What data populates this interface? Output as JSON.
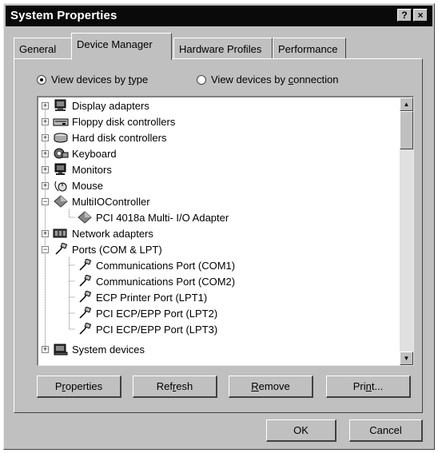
{
  "window": {
    "title": "System Properties",
    "help_label": "?",
    "close_label": "×"
  },
  "tabs": [
    {
      "label": "General"
    },
    {
      "label": "Device Manager"
    },
    {
      "label": "Hardware Profiles"
    },
    {
      "label": "Performance"
    }
  ],
  "view": {
    "by_type": {
      "prefix": "View devices by ",
      "accel": "t",
      "suffix": "ype",
      "selected": true
    },
    "by_connection": {
      "prefix": "View devices by ",
      "accel": "c",
      "suffix": "onnection",
      "selected": false
    }
  },
  "tree": [
    {
      "label": "Display adapters",
      "level": 0,
      "expander": "+",
      "icon": "display-adapter-icon"
    },
    {
      "label": "Floppy disk controllers",
      "level": 0,
      "expander": "+",
      "icon": "floppy-controller-icon"
    },
    {
      "label": "Hard disk controllers",
      "level": 0,
      "expander": "+",
      "icon": "hard-disk-controller-icon"
    },
    {
      "label": "Keyboard",
      "level": 0,
      "expander": "+",
      "icon": "keyboard-icon"
    },
    {
      "label": "Monitors",
      "level": 0,
      "expander": "+",
      "icon": "monitor-icon"
    },
    {
      "label": "Mouse",
      "level": 0,
      "expander": "+",
      "icon": "mouse-icon"
    },
    {
      "label": "MultiIOController",
      "level": 0,
      "expander": "-",
      "icon": "diamond-device-icon"
    },
    {
      "label": "PCI 4018a Multi- I/O Adapter",
      "level": 1,
      "icon": "diamond-device-icon"
    },
    {
      "label": "Network adapters",
      "level": 0,
      "expander": "+",
      "icon": "network-adapter-icon"
    },
    {
      "label": "Ports (COM & LPT)",
      "level": 0,
      "expander": "-",
      "icon": "port-connector-icon"
    },
    {
      "label": "Communications Port (COM1)",
      "level": 1,
      "icon": "port-connector-icon"
    },
    {
      "label": "Communications Port (COM2)",
      "level": 1,
      "icon": "port-connector-icon"
    },
    {
      "label": "ECP Printer Port (LPT1)",
      "level": 1,
      "icon": "port-connector-icon"
    },
    {
      "label": "PCI ECP/EPP Port (LPT2)",
      "level": 1,
      "icon": "port-connector-icon"
    },
    {
      "label": "PCI ECP/EPP Port (LPT3)",
      "level": 1,
      "icon": "port-connector-icon"
    },
    {
      "label": "System devices",
      "level": 0,
      "expander": "+",
      "icon": "system-devices-icon"
    }
  ],
  "buttons": {
    "properties": {
      "pre": "P",
      "accel": "r",
      "post": "operties"
    },
    "refresh": {
      "pre": "Ref",
      "accel": "r",
      "post": "esh"
    },
    "remove": {
      "pre": "",
      "accel": "R",
      "post": "emove"
    },
    "print": {
      "pre": "Pri",
      "accel": "n",
      "post": "t..."
    },
    "ok": "OK",
    "cancel": "Cancel"
  }
}
